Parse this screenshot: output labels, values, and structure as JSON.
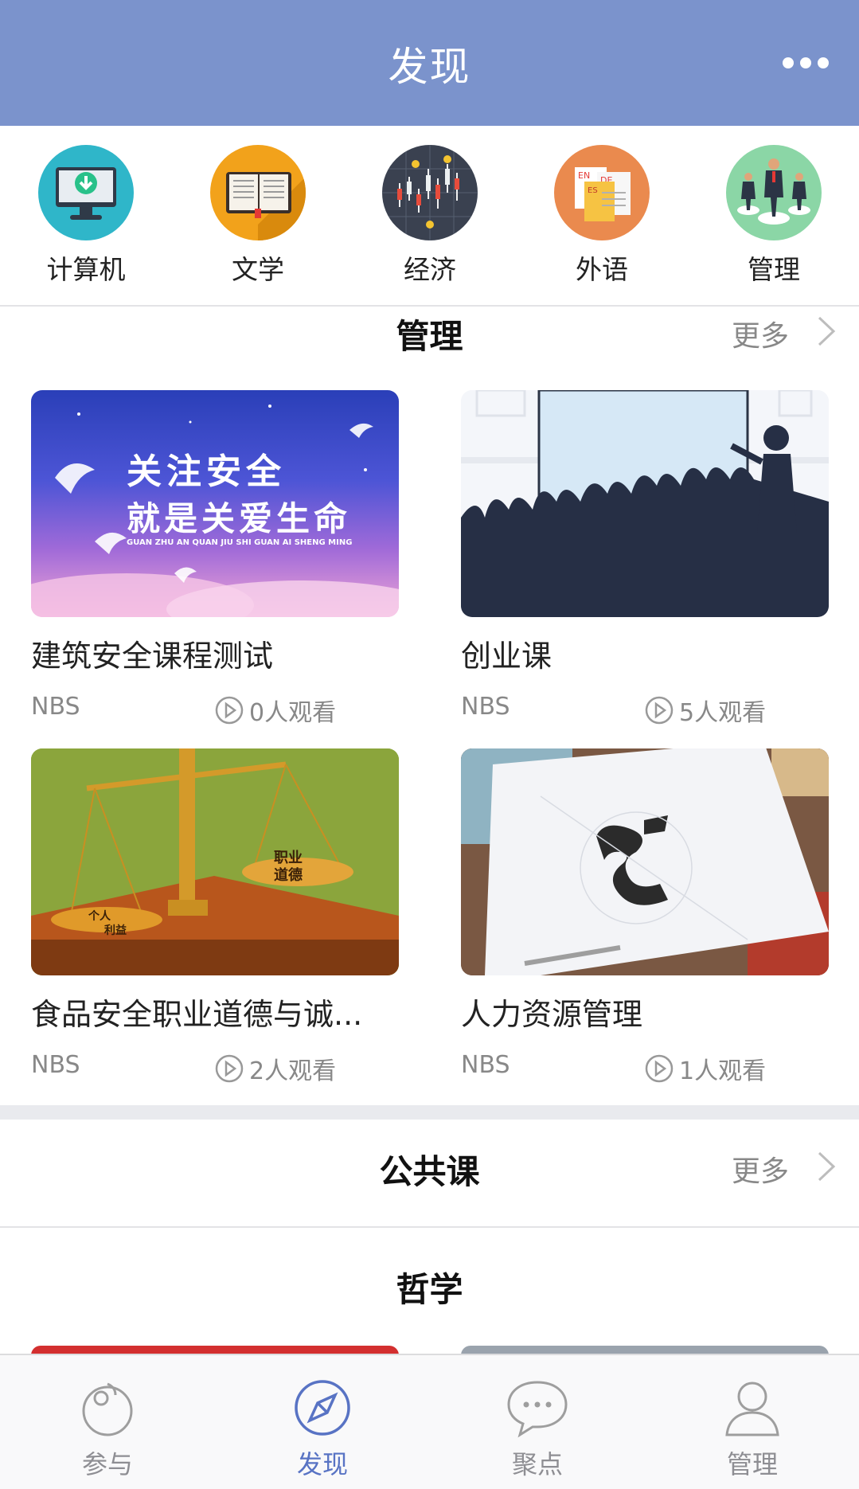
{
  "header": {
    "title": "发现",
    "more_icon": "more-dots-icon"
  },
  "categories": [
    {
      "label": "计算机",
      "icon": "computer-download-icon",
      "color": "#2fb6c9"
    },
    {
      "label": "文学",
      "icon": "open-book-icon",
      "color": "#f2a21b"
    },
    {
      "label": "经济",
      "icon": "stock-chart-icon",
      "color": "#3a4150"
    },
    {
      "label": "外语",
      "icon": "language-docs-icon",
      "color": "#ea8a4e"
    },
    {
      "label": "管理",
      "icon": "business-people-icon",
      "color": "#8bd6a6"
    }
  ],
  "sections": [
    {
      "title": "管理",
      "more": "更多",
      "courses": [
        {
          "title": "建筑安全课程测试",
          "org": "NBS",
          "views": "0人观看",
          "thumb_text_line1": "关注安全",
          "thumb_text_line2": "就是关爱生命",
          "thumb_pinyin": "GUAN ZHU AN QUAN JIU SHI GUAN AI SHENG MING"
        },
        {
          "title": "创业课",
          "org": "NBS",
          "views": "5人观看"
        },
        {
          "title": "食品安全职业道德与诚...",
          "org": "NBS",
          "views": "2人观看",
          "thumb_text_a": "职业",
          "thumb_text_b": "道德",
          "thumb_text_c": "个人",
          "thumb_text_d": "利益"
        },
        {
          "title": "人力资源管理",
          "org": "NBS",
          "views": "1人观看"
        }
      ]
    },
    {
      "title": "公共课",
      "more": "更多"
    }
  ],
  "subsection": {
    "title": "哲学"
  },
  "tabbar": {
    "items": [
      {
        "label": "参与",
        "icon": "participate-icon",
        "active": false
      },
      {
        "label": "发现",
        "icon": "compass-icon",
        "active": true
      },
      {
        "label": "聚点",
        "icon": "chat-bubble-icon",
        "active": false
      },
      {
        "label": "管理",
        "icon": "person-icon",
        "active": false
      }
    ]
  },
  "colors": {
    "header_bg": "#7b93cc",
    "accent": "#5873c4",
    "muted": "#8e8e93"
  }
}
